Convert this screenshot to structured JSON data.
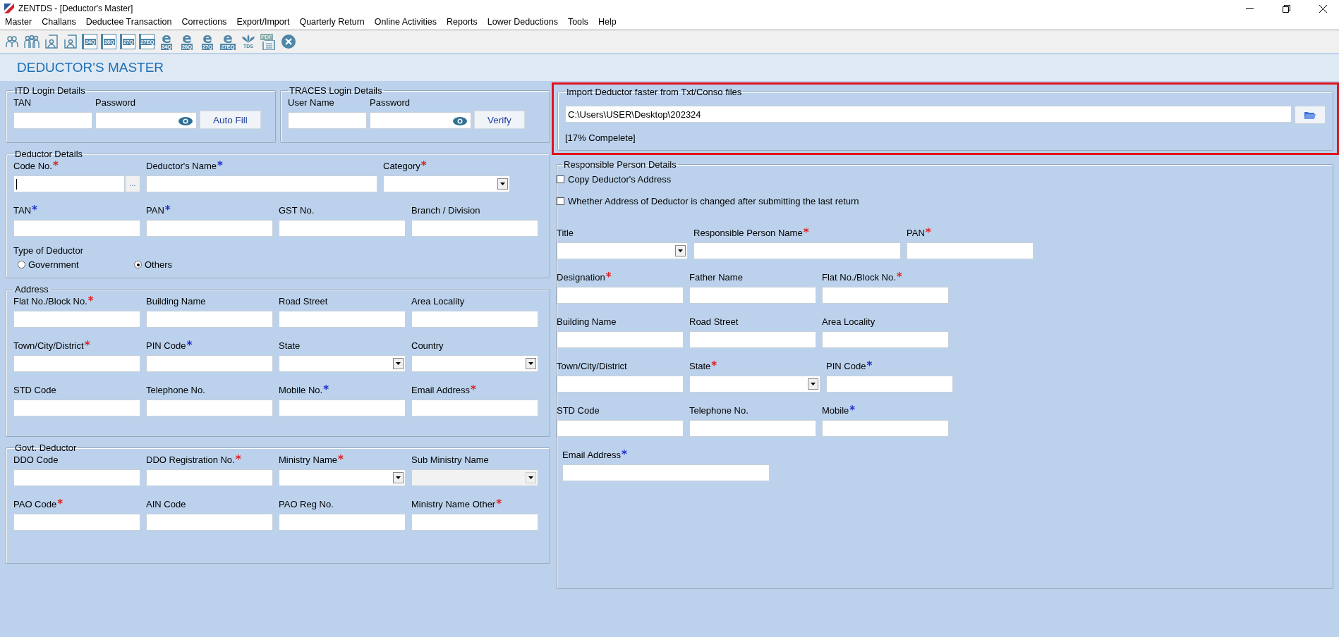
{
  "window": {
    "title": "ZENTDS - [Deductor's Master]"
  },
  "menu": [
    "Master",
    "Challans",
    "Deductee Transaction",
    "Corrections",
    "Export/Import",
    "Quarterly Return",
    "Online Activities",
    "Reports",
    "Lower Deductions",
    "Tools",
    "Help"
  ],
  "toolbar": [
    {
      "kind": "person"
    },
    {
      "kind": "group"
    },
    {
      "kind": "doc-person"
    },
    {
      "kind": "doc-person"
    },
    {
      "kind": "doc",
      "label": "24Q"
    },
    {
      "kind": "doc",
      "label": "26Q"
    },
    {
      "kind": "doc",
      "label": "27Q"
    },
    {
      "kind": "doc",
      "label": "27EQ"
    },
    {
      "kind": "e",
      "label": "24Q"
    },
    {
      "kind": "e",
      "label": "26Q"
    },
    {
      "kind": "e",
      "label": "27Q"
    },
    {
      "kind": "e",
      "label": "27EQ"
    },
    {
      "kind": "tds",
      "label": "TDS"
    },
    {
      "kind": "pdf",
      "label": "PDF"
    },
    {
      "kind": "close"
    }
  ],
  "page_title": "DEDUCTOR'S MASTER",
  "itd_login": {
    "title": "ITD Login Details",
    "fields": [
      {
        "label": "TAN",
        "kind": "text"
      },
      {
        "label": "Password",
        "kind": "password"
      }
    ],
    "button": "Auto Fill"
  },
  "traces_login": {
    "title": "TRACES Login Details",
    "fields": [
      {
        "label": "User Name",
        "kind": "text"
      },
      {
        "label": "Password",
        "kind": "password"
      }
    ],
    "button": "Verify"
  },
  "deductor_details": {
    "title": "Deductor Details",
    "rows": [
      [
        {
          "label": "Code No.",
          "mark": "*",
          "color": "#e02020",
          "kind": "code",
          "more": "..."
        },
        {
          "label": "Deductor's Name",
          "mark": "*",
          "color": "#1f2fd0",
          "kind": "wide"
        },
        {
          "label": "Category",
          "mark": "*",
          "color": "#e02020",
          "kind": "select"
        }
      ],
      [
        {
          "label": "TAN",
          "mark": "*",
          "color": "#1f2fd0",
          "kind": "text"
        },
        {
          "label": "PAN",
          "mark": "*",
          "color": "#1f2fd0",
          "kind": "text"
        },
        {
          "label": "GST No.",
          "kind": "text"
        },
        {
          "label": "Branch / Division",
          "kind": "text"
        }
      ]
    ],
    "type_label": "Type of Deductor",
    "types": [
      {
        "label": "Government",
        "selected": false
      },
      {
        "label": "Others",
        "selected": true
      }
    ]
  },
  "address": {
    "title": "Address",
    "rows": [
      [
        {
          "label": "Flat No./Block No.",
          "mark": "*",
          "color": "#e02020",
          "kind": "text"
        },
        {
          "label": "Building Name",
          "kind": "text"
        },
        {
          "label": "Road Street",
          "kind": "text"
        },
        {
          "label": "Area Locality",
          "kind": "text"
        }
      ],
      [
        {
          "label": "Town/City/District",
          "mark": "*",
          "color": "#e02020",
          "kind": "text"
        },
        {
          "label": "PIN Code",
          "mark": "*",
          "color": "#1f2fd0",
          "kind": "text"
        },
        {
          "label": "State",
          "kind": "select"
        },
        {
          "label": "Country",
          "kind": "select"
        }
      ],
      [
        {
          "label": "STD Code",
          "kind": "text"
        },
        {
          "label": "Telephone No.",
          "kind": "text"
        },
        {
          "label": "Mobile No.",
          "mark": "*",
          "color": "#1f2fd0",
          "kind": "text"
        },
        {
          "label": "Email Address",
          "mark": "*",
          "color": "#e02020",
          "kind": "text"
        }
      ]
    ]
  },
  "govt_deductor": {
    "title": "Govt. Deductor",
    "rows": [
      [
        {
          "label": "DDO Code",
          "kind": "text"
        },
        {
          "label": "DDO Registration No.",
          "mark": "*",
          "color": "#e02020",
          "kind": "text"
        },
        {
          "label": "Ministry Name",
          "mark": "*",
          "color": "#e02020",
          "kind": "select"
        },
        {
          "label": "Sub Ministry Name",
          "kind": "select",
          "disabled": true
        }
      ],
      [
        {
          "label": "PAO Code",
          "mark": "*",
          "color": "#e02020",
          "kind": "text"
        },
        {
          "label": "AIN Code",
          "kind": "text"
        },
        {
          "label": "PAO Reg No.",
          "kind": "text"
        },
        {
          "label": "Ministry Name Other",
          "mark": "*",
          "color": "#e02020",
          "kind": "text"
        }
      ]
    ]
  },
  "import": {
    "title": "Import Deductor faster from Txt/Conso files",
    "path": "C:\\Users\\USER\\Desktop\\202324",
    "progress": "[17% Compelete]"
  },
  "responsible_person": {
    "title": "Responsible Person Details",
    "checkboxes": [
      {
        "label": "Copy Deductor's Address",
        "checked": false
      },
      {
        "label": "Whether Address of Deductor is changed after submitting the last return",
        "checked": false
      }
    ],
    "rows": [
      [
        {
          "label": "Title",
          "kind": "select"
        },
        {
          "label": "Responsible Person Name",
          "mark": "*",
          "color": "#e02020",
          "kind": "wide"
        },
        {
          "label": "PAN",
          "mark": "*",
          "color": "#e02020",
          "kind": "text"
        }
      ],
      [
        {
          "label": "Designation",
          "mark": "*",
          "color": "#e02020",
          "kind": "text"
        },
        {
          "label": "Father Name",
          "kind": "text"
        },
        {
          "label": "Flat No./Block No.",
          "mark": "*",
          "color": "#e02020",
          "kind": "text"
        }
      ],
      [
        {
          "label": "Building Name",
          "kind": "text"
        },
        {
          "label": "Road Street",
          "kind": "text"
        },
        {
          "label": "Area Locality",
          "kind": "text"
        }
      ],
      [
        {
          "label": "Town/City/District",
          "kind": "text"
        },
        {
          "label": "State",
          "mark": "*",
          "color": "#e02020",
          "kind": "select"
        },
        {
          "label": "PIN Code",
          "mark": "*",
          "color": "#1f2fd0",
          "kind": "text"
        }
      ],
      [
        {
          "label": "STD Code",
          "kind": "text"
        },
        {
          "label": "Telephone No.",
          "kind": "text"
        },
        {
          "label": "Mobile",
          "mark": "*",
          "color": "#1f2fd0",
          "kind": "text"
        }
      ],
      [
        {
          "label": "Email Address",
          "mark": "*",
          "color": "#1f2fd0",
          "kind": "wide"
        }
      ]
    ]
  }
}
